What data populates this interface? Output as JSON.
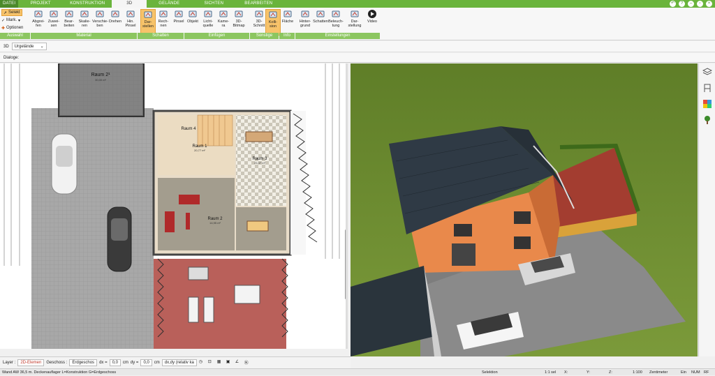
{
  "tabs": [
    {
      "label": "DATEI"
    },
    {
      "label": "PROJEKT"
    },
    {
      "label": "KONSTRUKTION"
    },
    {
      "label": "3D"
    },
    {
      "label": "GELÄNDE"
    },
    {
      "label": "SICHTEN"
    },
    {
      "label": "BEARBEITEN"
    }
  ],
  "auswahl": {
    "selekt": "Selekt",
    "mark": "Mark.",
    "optionen": "Optionen",
    "group": "Auswahl"
  },
  "ribbon_buttons": [
    {
      "label1": "Abgrei-",
      "label2": "fen"
    },
    {
      "label1": "Zuwei-",
      "label2": "sen"
    },
    {
      "label1": "Bear-",
      "label2": "beiten"
    },
    {
      "label1": "Skalie-",
      "label2": "ren"
    },
    {
      "label1": "Verschie-",
      "label2": "ben"
    },
    {
      "label1": "Drehen",
      "label2": ""
    },
    {
      "label1": "Hin.",
      "label2": "Pinsel"
    },
    {
      "label1": "Dar-",
      "label2": "stellen"
    },
    {
      "label1": "Rech-",
      "label2": "nen"
    },
    {
      "label1": "Pinsel",
      "label2": ""
    },
    {
      "label1": "Objekt",
      "label2": ""
    },
    {
      "label1": "Licht-",
      "label2": "quelle"
    },
    {
      "label1": "Kame-",
      "label2": "ra"
    },
    {
      "label1": "3D-",
      "label2": "Bitmap"
    },
    {
      "label1": "3D-",
      "label2": "Schnitt"
    },
    {
      "label1": "Kolli-",
      "label2": "sion"
    },
    {
      "label1": "Fläche",
      "label2": ""
    },
    {
      "label1": "Hinter-",
      "label2": "grund"
    },
    {
      "label1": "Schatten",
      "label2": ""
    },
    {
      "label1": "Beleuch-",
      "label2": "tung"
    },
    {
      "label1": "Dar-",
      "label2": "stellung"
    },
    {
      "label1": "Video",
      "label2": ""
    }
  ],
  "groups": [
    "Material",
    "Schatten",
    "Einfügen",
    "Sonstige",
    "Info",
    "Einstellungen"
  ],
  "view_select": {
    "mode": "3D",
    "floor": "Urgelände"
  },
  "dialoge_label": "Dialoge:",
  "plan": {
    "rooms": [
      {
        "name": "Raum 2¹",
        "area": "30,00 m²"
      },
      {
        "name": "Raum 4",
        "area": ""
      },
      {
        "name": "Raum 1",
        "area": "20,77 m²"
      },
      {
        "name": "Raum 3",
        "area": "25,37 m²"
      },
      {
        "name": "Raum 2",
        "area": "14,95 m²"
      }
    ]
  },
  "statusbar": {
    "layer_label": "Layer :",
    "layer_value": "2D-Elemen",
    "geschoss_label": "Geschoss :",
    "geschoss_value": "Erdgeschos",
    "dx_label": "dx =",
    "dx_value": "0,0",
    "dy_label": "dy =",
    "dy_value": "0,0",
    "cm": "cm",
    "mode": "dx,dy (relativ ka"
  },
  "footer": {
    "info": "Wand AW 36,5 m. Deckenauflager L=Konstruktion G=Erdgeschoss",
    "selektion": "Selektion",
    "sel": "1:1 sel",
    "x": "X:",
    "y": "Y:",
    "z": "Z:",
    "scale": "1:100",
    "unit": "Zentimeter",
    "ein": "Ein",
    "num": "NUM",
    "rf": "RF"
  },
  "colors": {
    "accent": "#6ab43c",
    "group": "#8cc660",
    "selected": "#f7c36a"
  }
}
